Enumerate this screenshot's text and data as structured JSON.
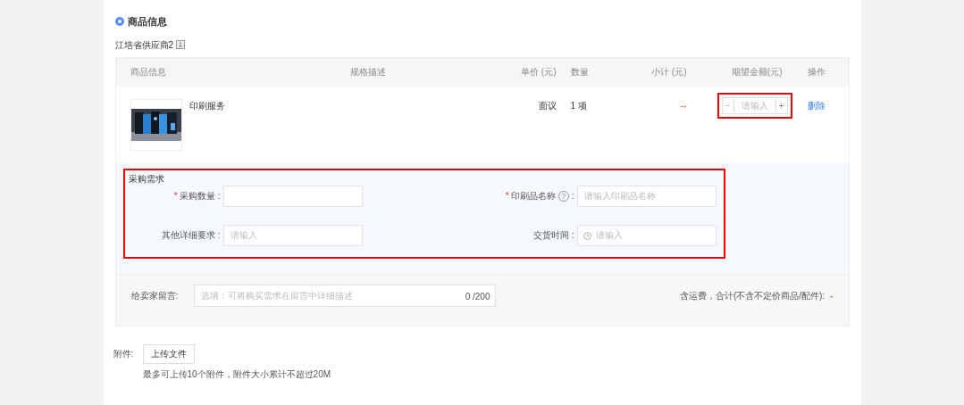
{
  "section_title": "商品信息",
  "supplier": "江培省供应商2",
  "table": {
    "columns": [
      "商品信息",
      "规格描述",
      "单价 (元)",
      "数量",
      "小计 (元)",
      "期望金额(元)",
      "操作"
    ],
    "rows": [
      {
        "name": "印刷服务",
        "price": "面议",
        "quantity": "1 项",
        "subtotal": "--",
        "expected": {
          "minus": "−",
          "placeholder": "请输入",
          "plus": "+"
        },
        "action": "删除"
      }
    ]
  },
  "requirements": {
    "title": "采购需求",
    "fields": [
      {
        "kind": "text",
        "mark": "*",
        "label": "采购数量",
        "colon": ":"
      },
      {
        "kind": "text",
        "mark": "*",
        "label": "印刷品名称",
        "help": "?",
        "colon": ":",
        "placeholder": "请输入印刷品名称"
      },
      {
        "kind": "text",
        "label": "其他详细要求",
        "colon": ":",
        "placeholder": "请输入"
      },
      {
        "kind": "date",
        "label": "交货时间",
        "colon": ":",
        "placeholder": "请输入"
      }
    ]
  },
  "message": {
    "label": "给卖家留言:",
    "placeholder": "选填：可将购买需求在留言中详细描述",
    "counter": "0 /200",
    "total_label": "含运费，合计(不含不定价商品/配件):",
    "total": "-"
  },
  "attachment": {
    "label": "附件:",
    "button": "上传文件",
    "hint": "最多可上传10个附件，附件大小累计不超过20M"
  }
}
